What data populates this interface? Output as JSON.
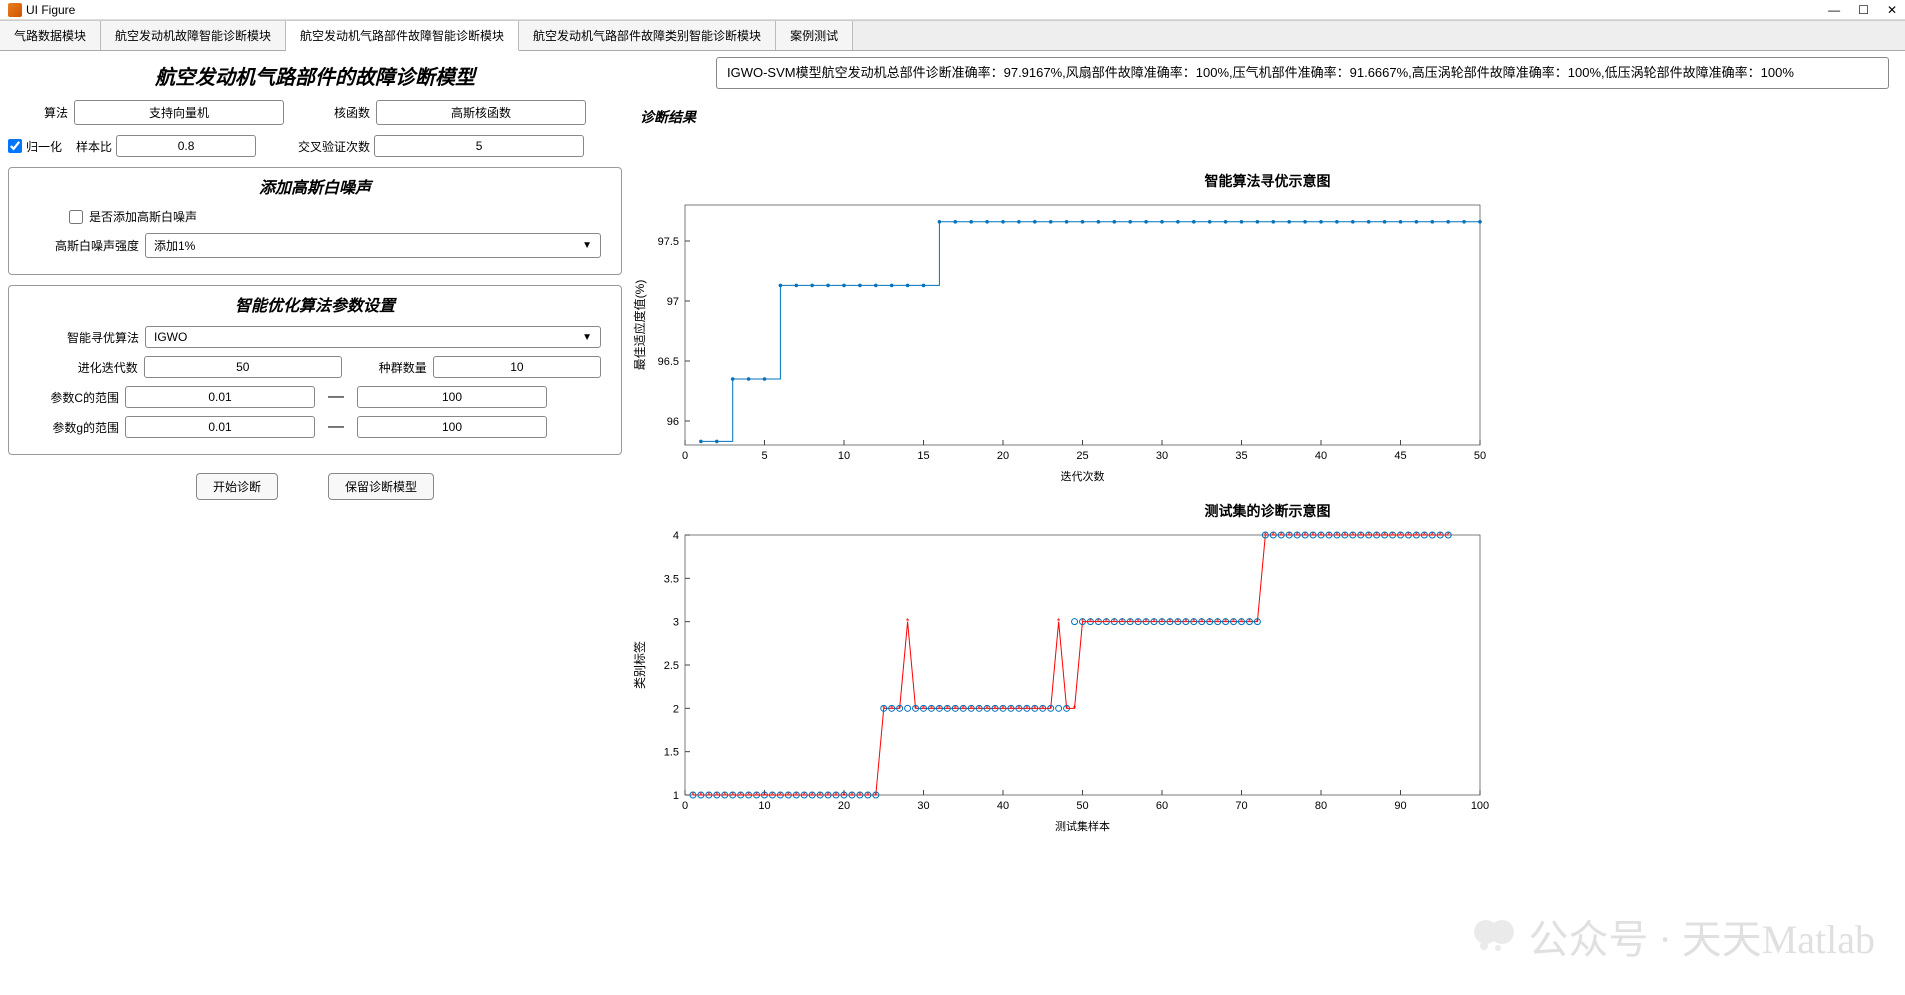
{
  "window": {
    "title": "UI Figure"
  },
  "tabs": [
    "气路数据模块",
    "航空发动机故障智能诊断模块",
    "航空发动机气路部件故障智能诊断模块",
    "航空发动机气路部件故障类别智能诊断模块",
    "案例测试"
  ],
  "heading": "航空发动机气路部件的故障诊断模型",
  "form": {
    "algo_label": "算法",
    "algo_value": "支持向量机",
    "kernel_label": "核函数",
    "kernel_value": "高斯核函数",
    "normalize_label": "归一化",
    "sample_ratio_label": "样本比",
    "sample_ratio_value": "0.8",
    "cv_label": "交叉验证次数",
    "cv_value": "5"
  },
  "noise": {
    "title": "添加高斯白噪声",
    "add_label": "是否添加高斯白噪声",
    "intensity_label": "高斯白噪声强度",
    "intensity_value": "添加1%"
  },
  "opt": {
    "title": "智能优化算法参数设置",
    "algo_label": "智能寻优算法",
    "algo_value": "IGWO",
    "iter_label": "进化迭代数",
    "iter_value": "50",
    "pop_label": "种群数量",
    "pop_value": "10",
    "c_label": "参数C的范围",
    "c_low": "0.01",
    "c_high": "100",
    "g_label": "参数g的范围",
    "g_low": "0.01",
    "g_high": "100"
  },
  "buttons": {
    "start": "开始诊断",
    "save": "保留诊断模型"
  },
  "result": {
    "label": "诊断结果",
    "text": "IGWO-SVM模型航空发动机总部件诊断准确率：97.9167%,风扇部件故障准确率：100%,压气机部件准确率：91.6667%,高压涡轮部件故障准确率：100%,低压涡轮部件故障准确率：100%"
  },
  "chart_data": [
    {
      "type": "line",
      "title": "智能算法寻优示意图",
      "xlabel": "迭代次数",
      "ylabel": "最佳适应度值(%)",
      "xlim": [
        0,
        50
      ],
      "ylim": [
        95.8,
        97.8
      ],
      "xticks": [
        0,
        5,
        10,
        15,
        20,
        25,
        30,
        35,
        40,
        45,
        50
      ],
      "yticks": [
        96,
        96.5,
        97,
        97.5
      ],
      "x": [
        1,
        2,
        3,
        4,
        5,
        6,
        7,
        8,
        9,
        10,
        11,
        12,
        13,
        14,
        15,
        16,
        17,
        18,
        19,
        20,
        21,
        22,
        23,
        24,
        25,
        26,
        27,
        28,
        29,
        30,
        31,
        32,
        33,
        34,
        35,
        36,
        37,
        38,
        39,
        40,
        41,
        42,
        43,
        44,
        45,
        46,
        47,
        48,
        49,
        50
      ],
      "y": [
        95.83,
        95.83,
        96.35,
        96.35,
        96.35,
        97.13,
        97.13,
        97.13,
        97.13,
        97.13,
        97.13,
        97.13,
        97.13,
        97.13,
        97.13,
        97.66,
        97.66,
        97.66,
        97.66,
        97.66,
        97.66,
        97.66,
        97.66,
        97.66,
        97.66,
        97.66,
        97.66,
        97.66,
        97.66,
        97.66,
        97.66,
        97.66,
        97.66,
        97.66,
        97.66,
        97.66,
        97.66,
        97.66,
        97.66,
        97.66,
        97.66,
        97.66,
        97.66,
        97.66,
        97.66,
        97.66,
        97.66,
        97.66,
        97.66,
        97.66
      ]
    },
    {
      "type": "line-scatter",
      "title": "测试集的诊断示意图",
      "xlabel": "测试集样本",
      "ylabel": "类别标签",
      "xlim": [
        0,
        100
      ],
      "ylim": [
        1,
        4
      ],
      "xticks": [
        0,
        10,
        20,
        30,
        40,
        50,
        60,
        70,
        80,
        90,
        100
      ],
      "yticks": [
        1,
        1.5,
        2,
        2.5,
        3,
        3.5,
        4
      ],
      "series": [
        {
          "name": "actual",
          "color": "#0072BD",
          "marker": "o"
        },
        {
          "name": "predicted",
          "color": "#D95319",
          "marker": "*"
        }
      ],
      "actual": [
        1,
        1,
        1,
        1,
        1,
        1,
        1,
        1,
        1,
        1,
        1,
        1,
        1,
        1,
        1,
        1,
        1,
        1,
        1,
        1,
        1,
        1,
        1,
        1,
        2,
        2,
        2,
        2,
        2,
        2,
        2,
        2,
        2,
        2,
        2,
        2,
        2,
        2,
        2,
        2,
        2,
        2,
        2,
        2,
        2,
        2,
        2,
        2,
        3,
        3,
        3,
        3,
        3,
        3,
        3,
        3,
        3,
        3,
        3,
        3,
        3,
        3,
        3,
        3,
        3,
        3,
        3,
        3,
        3,
        3,
        3,
        3,
        4,
        4,
        4,
        4,
        4,
        4,
        4,
        4,
        4,
        4,
        4,
        4,
        4,
        4,
        4,
        4,
        4,
        4,
        4,
        4,
        4,
        4,
        4,
        4
      ],
      "predicted": [
        1,
        1,
        1,
        1,
        1,
        1,
        1,
        1,
        1,
        1,
        1,
        1,
        1,
        1,
        1,
        1,
        1,
        1,
        1,
        1,
        1,
        1,
        1,
        1,
        2,
        2,
        2,
        3,
        2,
        2,
        2,
        2,
        2,
        2,
        2,
        2,
        2,
        2,
        2,
        2,
        2,
        2,
        2,
        2,
        2,
        2,
        3,
        2,
        2,
        3,
        3,
        3,
        3,
        3,
        3,
        3,
        3,
        3,
        3,
        3,
        3,
        3,
        3,
        3,
        3,
        3,
        3,
        3,
        3,
        3,
        3,
        3,
        4,
        4,
        4,
        4,
        4,
        4,
        4,
        4,
        4,
        4,
        4,
        4,
        4,
        4,
        4,
        4,
        4,
        4,
        4,
        4,
        4,
        4,
        4,
        4
      ]
    }
  ],
  "watermark": "公众号 · 天天Matlab"
}
